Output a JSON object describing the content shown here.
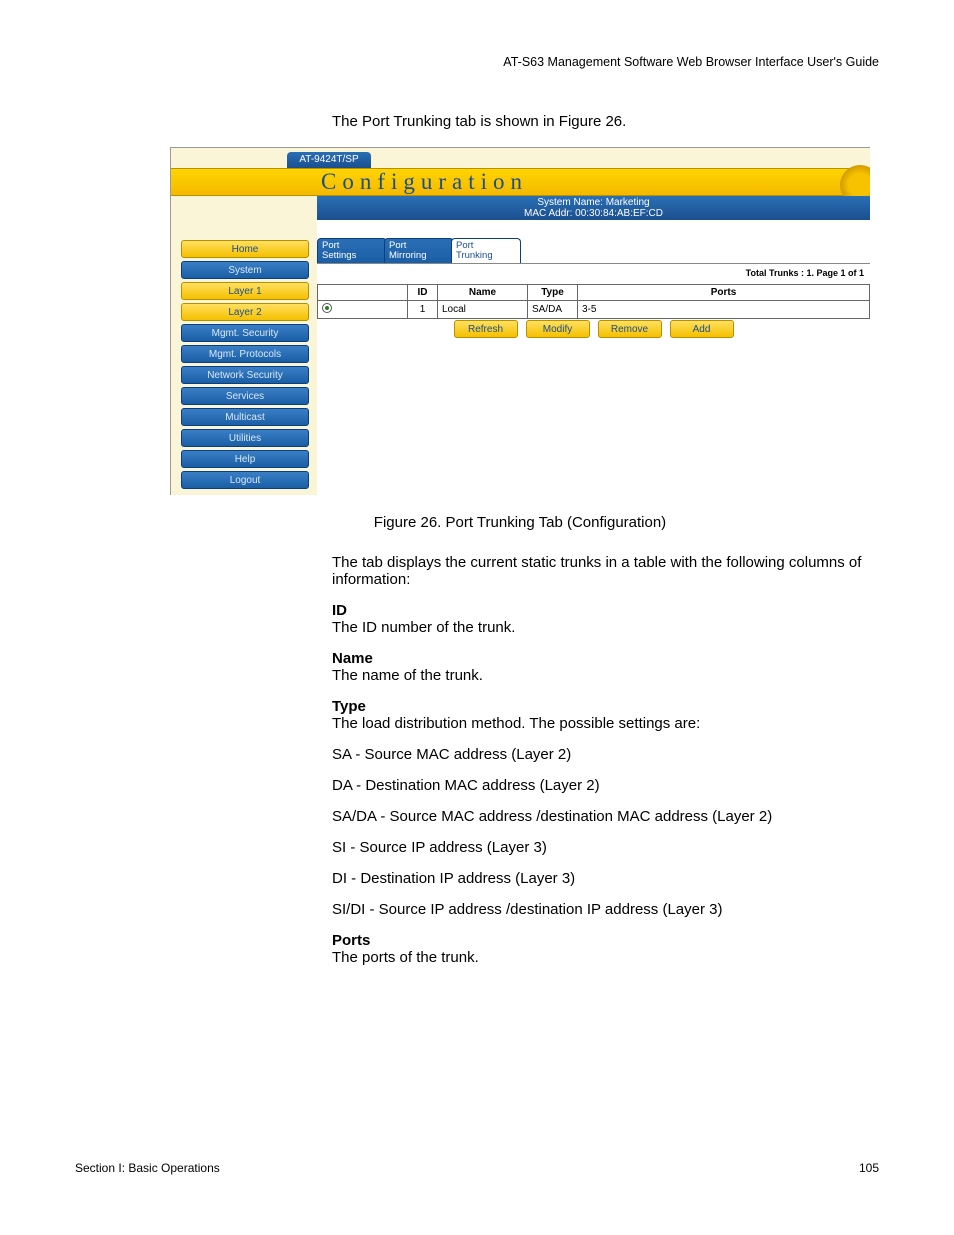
{
  "header": "AT-S63 Management Software Web Browser Interface User's Guide",
  "intro": "The Port Trunking tab is shown in Figure 26.",
  "shot": {
    "model": "AT-9424T/SP",
    "title": "Configuration",
    "sys_name": "System Name: Marketing",
    "mac": "MAC Addr: 00:30:84:AB:EF:CD",
    "nav": [
      "Home",
      "System",
      "Layer 1",
      "Layer 2",
      "Mgmt. Security",
      "Mgmt. Protocols",
      "Network Security",
      "Services",
      "Multicast",
      "Utilities",
      "Help",
      "Logout"
    ],
    "nav_gold": [
      0,
      2,
      3
    ],
    "tabs": [
      "Port Settings",
      "Port Mirroring",
      "Port Trunking"
    ],
    "totals": "Total Trunks : 1. Page 1 of 1",
    "cols": [
      "",
      "ID",
      "Name",
      "Type",
      "Ports"
    ],
    "row": {
      "id": "1",
      "name": "Local",
      "type": "SA/DA",
      "ports": "3-5"
    },
    "actions": [
      "Refresh",
      "Modify",
      "Remove",
      "Add"
    ]
  },
  "caption": "Figure 26. Port Trunking Tab (Configuration)",
  "para1": "The tab displays the current static trunks in a table with the following columns of information:",
  "defs": [
    {
      "t": "ID",
      "d": "The ID number of the trunk."
    },
    {
      "t": "Name",
      "d": "The name of the trunk."
    },
    {
      "t": "Type",
      "d": "The load distribution method. The possible settings are:"
    }
  ],
  "type_list": [
    "SA - Source MAC address (Layer 2)",
    "DA - Destination MAC address (Layer 2)",
    "SA/DA - Source MAC address /destination MAC address (Layer 2)",
    "SI - Source IP address (Layer 3)",
    "DI - Destination IP address (Layer 3)",
    "SI/DI - Source IP address /destination IP address (Layer 3)"
  ],
  "ports_def": {
    "t": "Ports",
    "d": "The ports of the trunk."
  },
  "footer": {
    "left": "Section I: Basic Operations",
    "right": "105"
  }
}
